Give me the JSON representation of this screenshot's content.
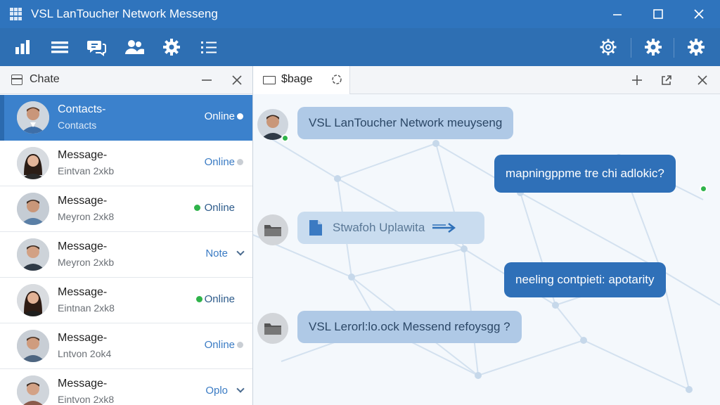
{
  "window": {
    "title": "VSL LanToucher Network Messeng",
    "minimize": "–",
    "maximize": "☐",
    "close": "✕"
  },
  "toolbar": {
    "left_icons": [
      "stats-icon",
      "list-icon",
      "chat-icon",
      "users-icon",
      "settings-icon",
      "checklist-icon"
    ],
    "right_icons": [
      "settings-outline-icon",
      "settings-icon",
      "settings-icon"
    ]
  },
  "contacts_panel": {
    "title": "Chate",
    "minimize": "—",
    "close": "✕",
    "items": [
      {
        "name": "Contacts-",
        "sub": "Contacts",
        "status": "Online",
        "indicator": "white-dot",
        "active": true
      },
      {
        "name": "Message-",
        "sub": "Eintvan 2xkb",
        "status": "Online",
        "indicator": "gray-dot"
      },
      {
        "name": "Message-",
        "sub": "Meyron 2xk8",
        "status": "Online",
        "indicator": "green-dot"
      },
      {
        "name": "Message-",
        "sub": "Meyron 2xkb",
        "status": "Note",
        "indicator": "chevron"
      },
      {
        "name": "Message-",
        "sub": "Eintnan 2xk8",
        "status": "Online",
        "indicator": "green-dot"
      },
      {
        "name": "Message-",
        "sub": "Lntvon 2ok4",
        "status": "Online",
        "indicator": "gray-dot"
      },
      {
        "name": "Message-",
        "sub": "Eintvon 2xk8",
        "status": "Oplo",
        "indicator": "chevron"
      }
    ]
  },
  "chat": {
    "tab_label": "$bage",
    "add": "+",
    "popout": "⤢",
    "close": "✕",
    "messages": [
      {
        "dir": "in",
        "text": "VSL LanToucher Network meuyseng",
        "avatar": "person"
      },
      {
        "dir": "out",
        "text": "mapningppme tre chi adlokic?"
      },
      {
        "dir": "in",
        "text": "Stwafoh Uplawita",
        "avatar": "folder",
        "attachment": true
      },
      {
        "dir": "out",
        "text": "neeling contpieti: apotarity"
      },
      {
        "dir": "in",
        "text": "VSL Lerorl:lo.ock Messend refoysgg ?",
        "avatar": "folder"
      }
    ]
  },
  "colors": {
    "titlebar": "#2f74bd",
    "toolbar": "#2e6fb3",
    "active_contact": "#3b81cc",
    "outgoing_bubble": "#2f70b8",
    "incoming_bubble": "#afc9e6",
    "online_green": "#2fb34a"
  }
}
